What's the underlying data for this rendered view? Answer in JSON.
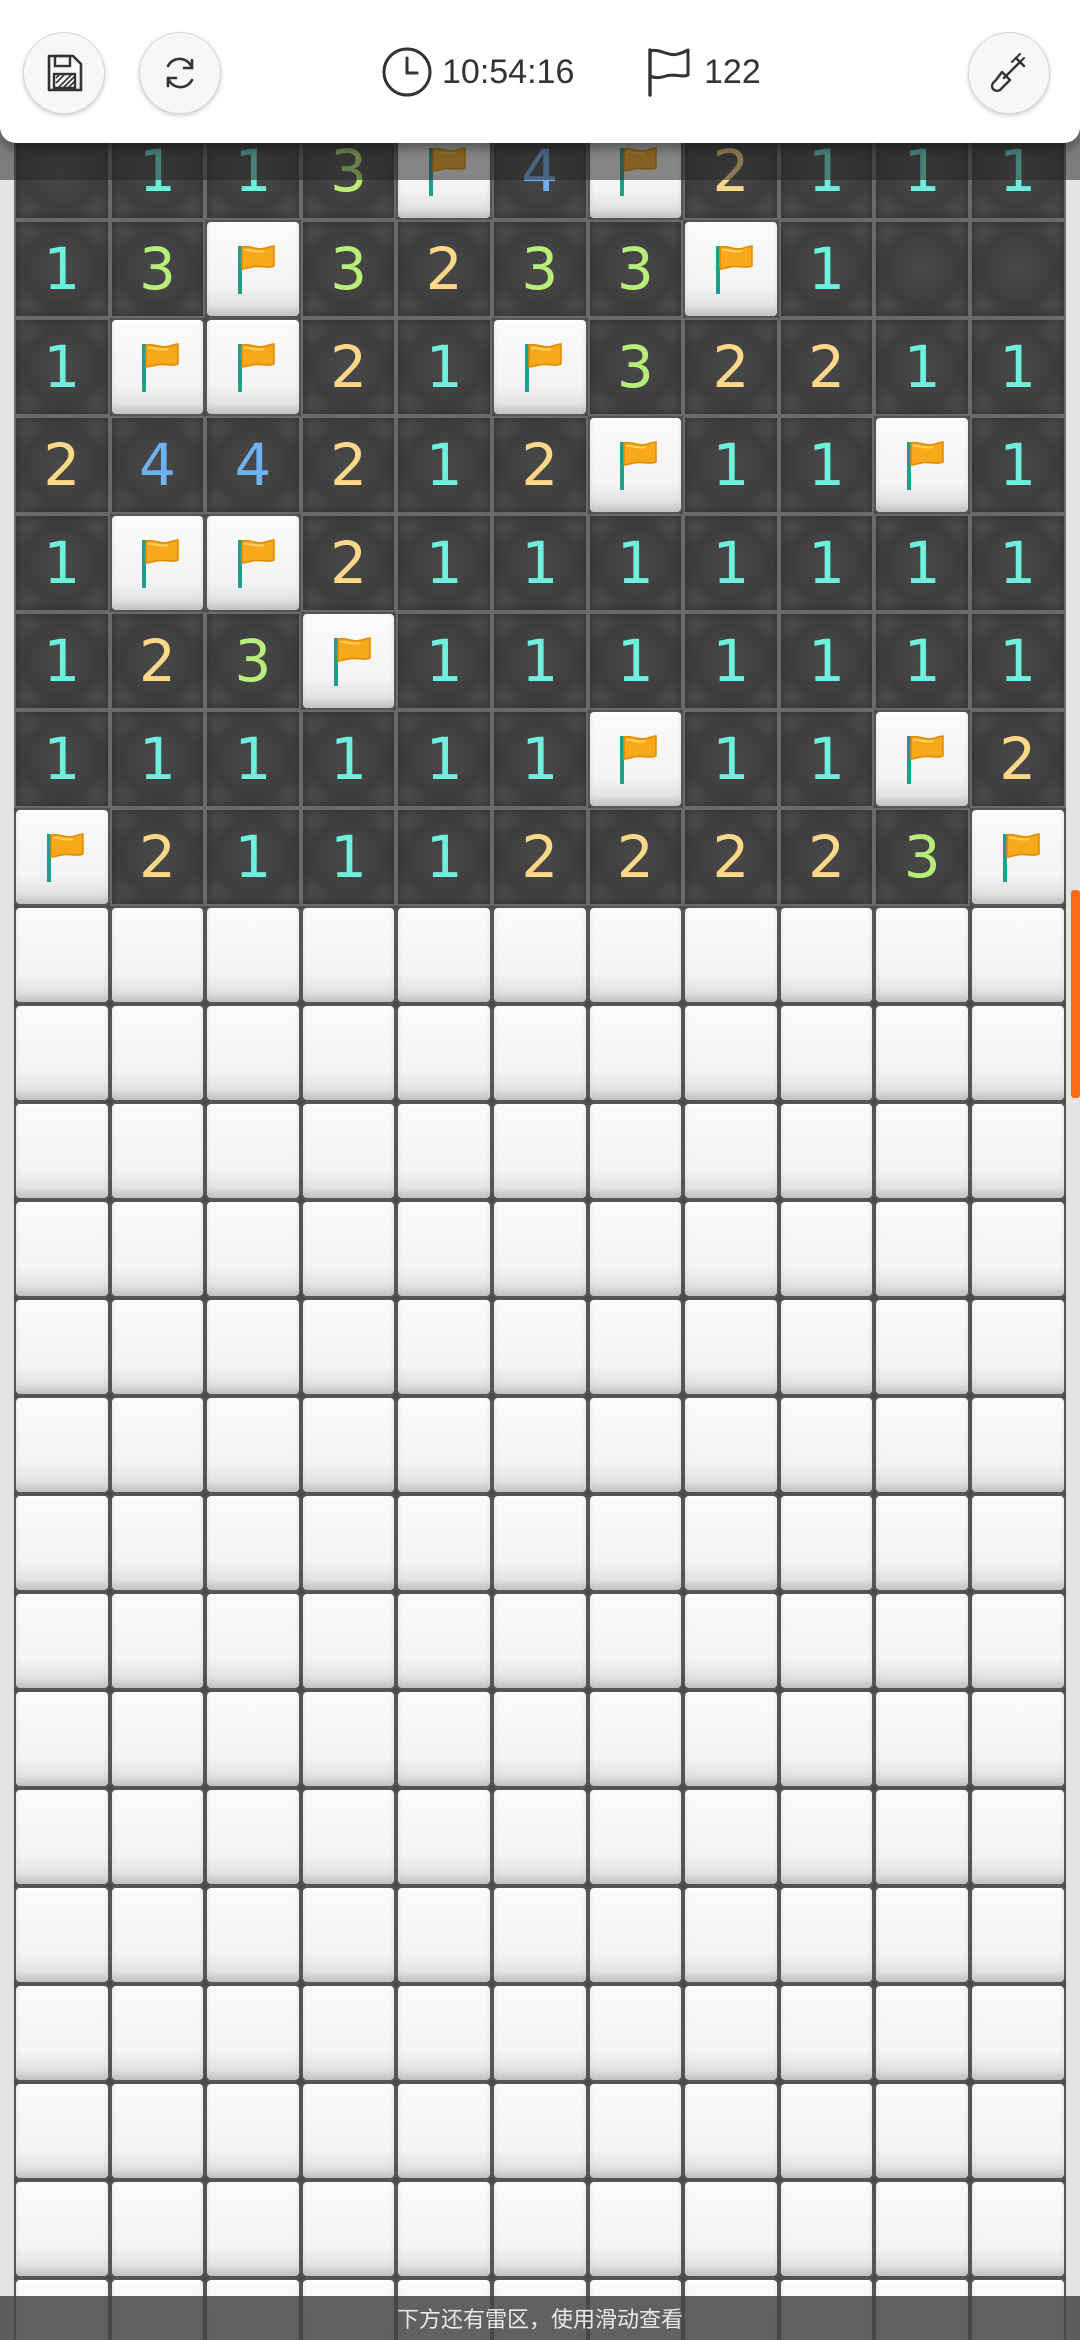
{
  "header": {
    "timer": "10:54:16",
    "flag_count": "122",
    "icons": {
      "save": "floppy-disk-icon",
      "restart": "refresh-icon",
      "timer": "clock-icon",
      "flags": "flag-outline-icon",
      "dig": "shovel-icon"
    }
  },
  "colors": {
    "n1": "#6ef0dc",
    "n2": "#ffd88a",
    "n3": "#b8ee7a",
    "n4": "#6fb2f2",
    "flag_orange": "#f7a91b",
    "scroll_indicator": "#ff6a1a"
  },
  "board": {
    "columns": 11,
    "rows": [
      [
        "open",
        "1",
        "1",
        "3",
        "F",
        "4",
        "F",
        "2",
        "1",
        "1",
        "1"
      ],
      [
        "1",
        "3",
        "F",
        "3",
        "2",
        "3",
        "3",
        "F",
        "1",
        "open",
        "open"
      ],
      [
        "1",
        "F",
        "F",
        "2",
        "1",
        "F",
        "3",
        "2",
        "2",
        "1",
        "1"
      ],
      [
        "2",
        "4",
        "4",
        "2",
        "1",
        "2",
        "F",
        "1",
        "1",
        "F",
        "1"
      ],
      [
        "1",
        "F",
        "F",
        "2",
        "1",
        "1",
        "1",
        "1",
        "1",
        "1",
        "1"
      ],
      [
        "1",
        "2",
        "3",
        "F",
        "1",
        "1",
        "1",
        "1",
        "1",
        "1",
        "1"
      ],
      [
        "1",
        "1",
        "1",
        "1",
        "1",
        "1",
        "F",
        "1",
        "1",
        "F",
        "2"
      ],
      [
        "F",
        "2",
        "1",
        "1",
        "1",
        "2",
        "2",
        "2",
        "2",
        "3",
        "F"
      ],
      [
        "C",
        "C",
        "C",
        "C",
        "C",
        "C",
        "C",
        "C",
        "C",
        "C",
        "C"
      ],
      [
        "C",
        "C",
        "C",
        "C",
        "C",
        "C",
        "C",
        "C",
        "C",
        "C",
        "C"
      ],
      [
        "C",
        "C",
        "C",
        "C",
        "C",
        "C",
        "C",
        "C",
        "C",
        "C",
        "C"
      ],
      [
        "C",
        "C",
        "C",
        "C",
        "C",
        "C",
        "C",
        "C",
        "C",
        "C",
        "C"
      ],
      [
        "C",
        "C",
        "C",
        "C",
        "C",
        "C",
        "C",
        "C",
        "C",
        "C",
        "C"
      ],
      [
        "C",
        "C",
        "C",
        "C",
        "C",
        "C",
        "C",
        "C",
        "C",
        "C",
        "C"
      ],
      [
        "C",
        "C",
        "C",
        "C",
        "C",
        "C",
        "C",
        "C",
        "C",
        "C",
        "C"
      ],
      [
        "C",
        "C",
        "C",
        "C",
        "C",
        "C",
        "C",
        "C",
        "C",
        "C",
        "C"
      ],
      [
        "C",
        "C",
        "C",
        "C",
        "C",
        "C",
        "C",
        "C",
        "C",
        "C",
        "C"
      ],
      [
        "C",
        "C",
        "C",
        "C",
        "C",
        "C",
        "C",
        "C",
        "C",
        "C",
        "C"
      ],
      [
        "C",
        "C",
        "C",
        "C",
        "C",
        "C",
        "C",
        "C",
        "C",
        "C",
        "C"
      ],
      [
        "C",
        "C",
        "C",
        "C",
        "C",
        "C",
        "C",
        "C",
        "C",
        "C",
        "C"
      ],
      [
        "C",
        "C",
        "C",
        "C",
        "C",
        "C",
        "C",
        "C",
        "C",
        "C",
        "C"
      ],
      [
        "C",
        "C",
        "C",
        "C",
        "C",
        "C",
        "C",
        "C",
        "C",
        "C",
        "C"
      ],
      [
        "C",
        "C",
        "C",
        "C",
        "C",
        "C",
        "C",
        "C",
        "C",
        "C",
        "C"
      ]
    ]
  },
  "footer": {
    "hint": "下方还有雷区，使用滑动查看"
  }
}
